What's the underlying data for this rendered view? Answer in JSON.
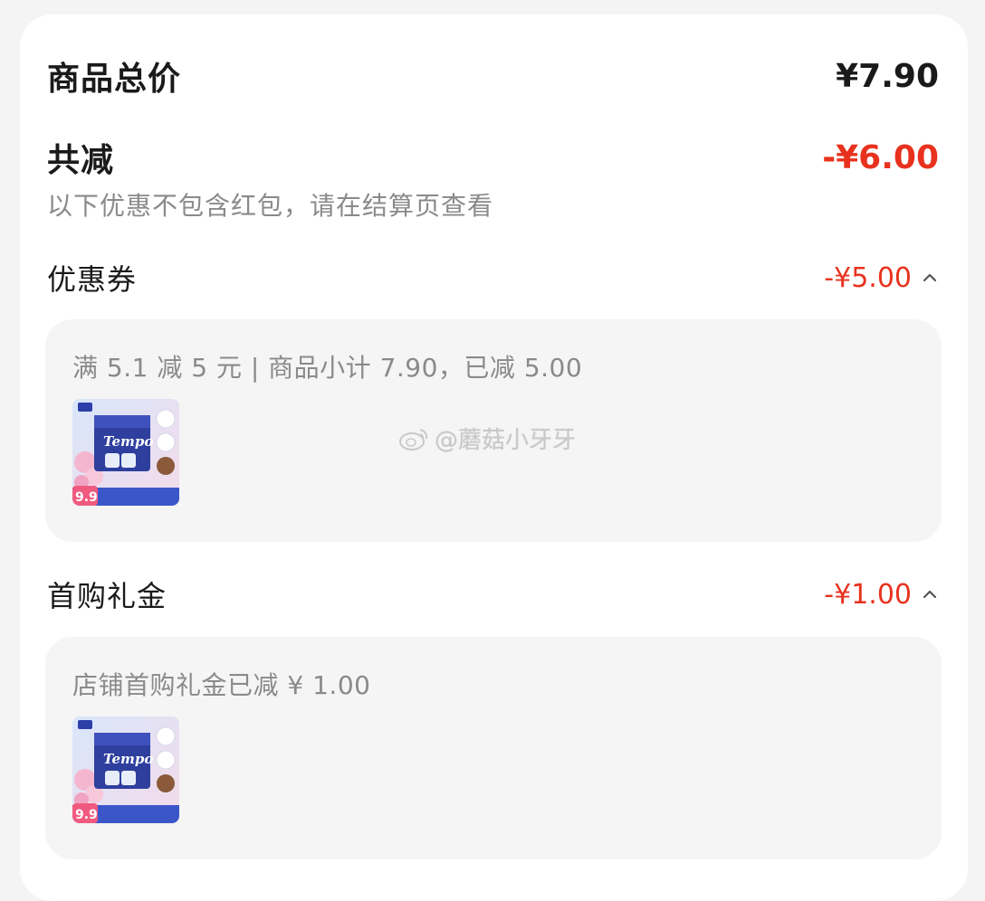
{
  "summary": {
    "total_label": "商品总价",
    "total_amount": "¥7.90",
    "discount_label": "共减",
    "discount_amount": "-¥6.00",
    "note": "以下优惠不包含红包，请在结算页查看"
  },
  "sections": [
    {
      "label": "优惠券",
      "amount": "-¥5.00",
      "detail": "满 5.1 减 5 元 | 商品小计 7.90，已减 5.00",
      "product_brand": "Tempo",
      "product_price_tag": "9.9"
    },
    {
      "label": "首购礼金",
      "amount": "-¥1.00",
      "detail": "店铺首购礼金已减 ¥ 1.00",
      "product_brand": "Tempo",
      "product_price_tag": "9.9"
    }
  ],
  "watermark": "@蘑菇小牙牙",
  "colors": {
    "accent_red": "#e8321e",
    "text_primary": "#1a1a1a",
    "text_secondary": "#8a8a8a",
    "panel_bg": "#f5f5f5"
  },
  "icons": [
    "chevron-up-icon",
    "weibo-icon"
  ]
}
